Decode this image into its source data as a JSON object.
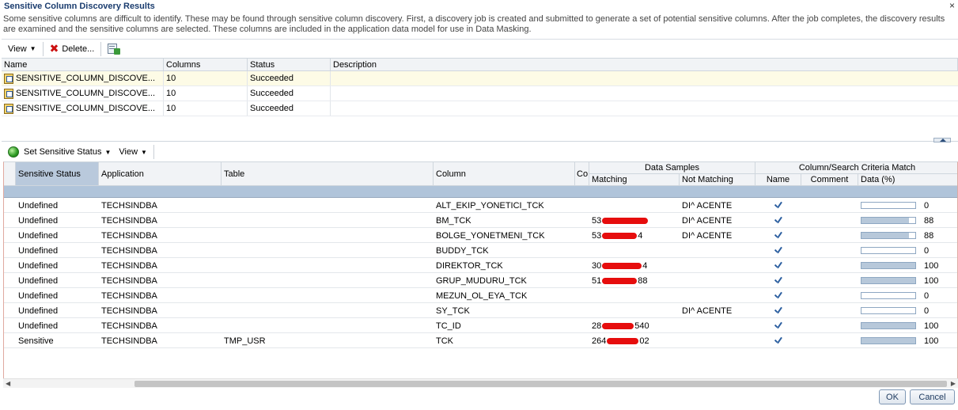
{
  "dialog": {
    "title": "Sensitive Column Discovery Results",
    "close_label": "×",
    "description": "Some sensitive columns are difficult to identify. These may be found through sensitive column discovery. First, a discovery job is created and submitted to generate a set of potential sensitive columns. After the job completes, the discovery results are examined and the sensitive columns are selected. These columns are included in the application data model for use in Data Masking."
  },
  "toolbar1": {
    "view_label": "View",
    "delete_label": "Delete...",
    "export_icon": "export-icon"
  },
  "jobs_table": {
    "headers": {
      "name": "Name",
      "columns": "Columns",
      "status": "Status",
      "description": "Description"
    },
    "rows": [
      {
        "name": "SENSITIVE_COLUMN_DISCOVE...",
        "columns": "10",
        "status": "Succeeded",
        "description": ""
      },
      {
        "name": "SENSITIVE_COLUMN_DISCOVE...",
        "columns": "10",
        "status": "Succeeded",
        "description": ""
      },
      {
        "name": "SENSITIVE_COLUMN_DISCOVE...",
        "columns": "10",
        "status": "Succeeded",
        "description": ""
      }
    ]
  },
  "toolbar2": {
    "set_status_label": "Set Sensitive Status",
    "view_label": "View"
  },
  "results": {
    "headers": {
      "sensitive_status": "Sensitive Status",
      "application": "Application",
      "table": "Table",
      "column": "Column",
      "co": "Co",
      "data_samples": "Data Samples",
      "matching": "Matching",
      "not_matching": "Not Matching",
      "criteria_match": "Column/Search Criteria Match",
      "name": "Name",
      "comment": "Comment",
      "data_pct": "Data (%)"
    },
    "rows": [
      {
        "status": "Undefined",
        "app": "TECHSINDBA",
        "table": "",
        "column": "ALT_EKIP_YONETICI_TCK",
        "match_pre": "",
        "match_post": "",
        "redact": 0,
        "not_match": "DI^ ACENTE",
        "data": 0
      },
      {
        "status": "Undefined",
        "app": "TECHSINDBA",
        "table": "",
        "column": "BM_TCK",
        "match_pre": "53",
        "match_post": "",
        "redact": 58,
        "not_match": "DI^ ACENTE",
        "data": 88
      },
      {
        "status": "Undefined",
        "app": "TECHSINDBA",
        "table": "",
        "column": "BOLGE_YONETMENI_TCK",
        "match_pre": "53",
        "match_post": "4",
        "redact": 44,
        "not_match": "DI^ ACENTE",
        "data": 88
      },
      {
        "status": "Undefined",
        "app": "TECHSINDBA",
        "table": "",
        "column": "BUDDY_TCK",
        "match_pre": "",
        "match_post": "",
        "redact": 0,
        "not_match": "",
        "data": 0
      },
      {
        "status": "Undefined",
        "app": "TECHSINDBA",
        "table": "",
        "column": "DIREKTOR_TCK",
        "match_pre": "30",
        "match_post": "4",
        "redact": 50,
        "not_match": "",
        "data": 100
      },
      {
        "status": "Undefined",
        "app": "TECHSINDBA",
        "table": "",
        "column": "GRUP_MUDURU_TCK",
        "match_pre": "51",
        "match_post": "88",
        "redact": 44,
        "not_match": "",
        "data": 100
      },
      {
        "status": "Undefined",
        "app": "TECHSINDBA",
        "table": "",
        "column": "MEZUN_OL_EYA_TCK",
        "match_pre": "",
        "match_post": "",
        "redact": 0,
        "not_match": "",
        "data": 0
      },
      {
        "status": "Undefined",
        "app": "TECHSINDBA",
        "table": "",
        "column": "SY_TCK",
        "match_pre": "",
        "match_post": "",
        "redact": 0,
        "not_match": "DI^ ACENTE",
        "data": 0
      },
      {
        "status": "Undefined",
        "app": "TECHSINDBA",
        "table": "",
        "column": "TC_ID",
        "match_pre": "28",
        "match_post": "540",
        "redact": 40,
        "not_match": "",
        "data": 100
      },
      {
        "status": "Sensitive",
        "app": "TECHSINDBA",
        "table": "TMP_USR",
        "column": "TCK",
        "match_pre": "264",
        "match_post": "02",
        "redact": 40,
        "not_match": "",
        "data": 100
      }
    ]
  },
  "footer": {
    "ok_label": "OK",
    "cancel_label": "Cancel"
  }
}
